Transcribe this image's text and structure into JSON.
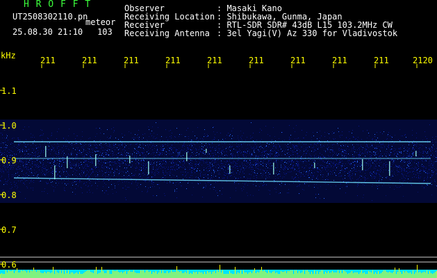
{
  "header": {
    "logo": "H R O F F T",
    "filename": "UT2508302110.pn",
    "type": "meteor",
    "datetime": "25.08.30 21:10",
    "count": "103"
  },
  "info": {
    "labels": [
      "Observer",
      "Receiving Location",
      "Receiver",
      "Receiving Antenna"
    ],
    "values": [
      ": Masaki Kano",
      ": Shibukawa, Gunma, Japan",
      ": RTL-SDR SDR# 43dB L15 103.2MHz CW",
      ": 3el Yagi(V) Az 330 for Vladivostok"
    ]
  },
  "time_axis": {
    "labels": [
      "211",
      "211",
      "211",
      "211",
      "211",
      "211",
      "211",
      "211",
      "211",
      "2120"
    ]
  },
  "freq_axis": {
    "unit": "kHz",
    "labels": [
      "1.1",
      "1.0",
      "0.9",
      "0.8",
      "0.7",
      "0.6"
    ]
  },
  "colors": {
    "background": "#000000",
    "noise_dark": "#0a1a9a",
    "noise_bright": "#2a6cff",
    "carrier": "#6fe0ff",
    "meteor": "#9ffff0",
    "baseline_yellow": "#ffff00",
    "baseline_cyan": "#00e5ff",
    "text_green": "#3cff3c",
    "text_white": "#ffffff",
    "text_yellow": "#ffff00"
  }
}
